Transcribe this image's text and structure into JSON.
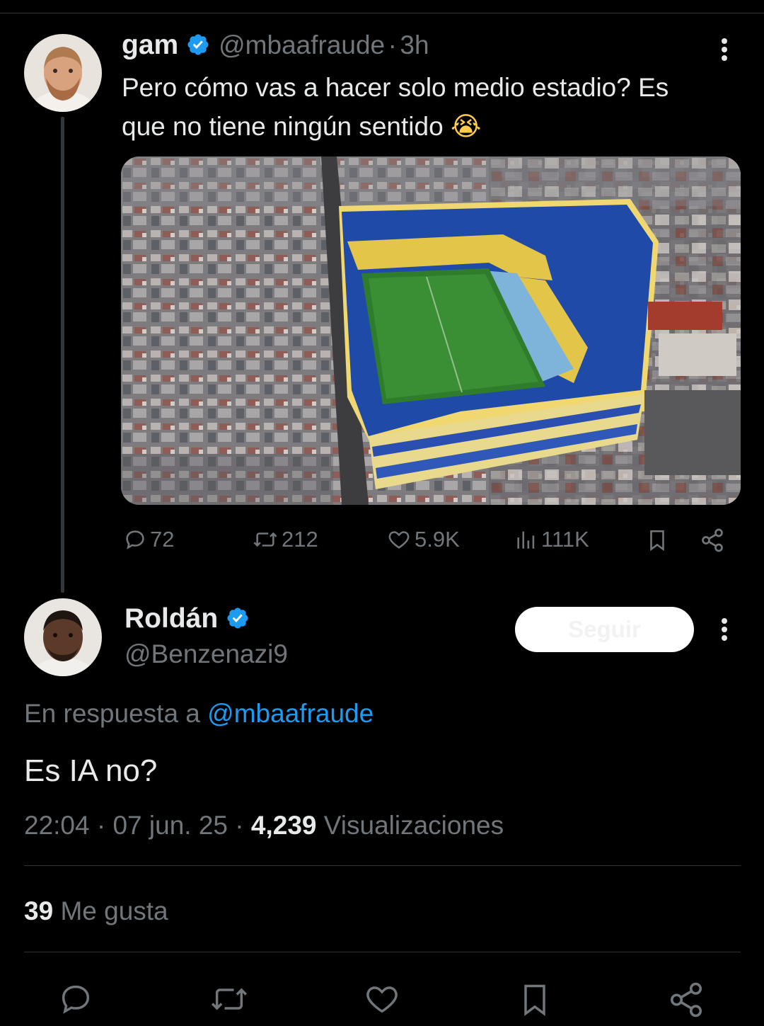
{
  "original_tweet": {
    "author_name": "gam",
    "handle": "@mbaafraude",
    "separator": "·",
    "time": "3h",
    "text_line1": "Pero cómo vas a hacer solo medio estadio? Es",
    "text_line2": "que no tiene ningún sentido",
    "emoji": "😭",
    "stats": {
      "replies": "72",
      "reposts": "212",
      "likes": "5.9K",
      "views": "111K"
    }
  },
  "reply": {
    "author_name": "Roldán",
    "handle": "@Benzenazi9",
    "follow_label": "Seguir",
    "in_reply_prefix": "En respuesta a",
    "in_reply_handle": "@mbaafraude",
    "text": "Es IA no?",
    "time": "22:04",
    "dot": "·",
    "date": "07 jun. 25",
    "views_count": "4,239",
    "views_label": "Visualizaciones",
    "likes_count": "39",
    "likes_label": "Me gusta"
  },
  "icons": {
    "verified": "verified-badge-icon",
    "more": "more-vertical-icon",
    "reply": "reply-icon",
    "repost": "repost-icon",
    "like": "heart-icon",
    "views": "views-chart-icon",
    "bookmark": "bookmark-icon",
    "share": "share-icon"
  },
  "colors": {
    "background": "#000000",
    "text": "#e7e9ea",
    "secondary": "#71767b",
    "link": "#1d9bf0",
    "verified": "#1d9bf0"
  }
}
